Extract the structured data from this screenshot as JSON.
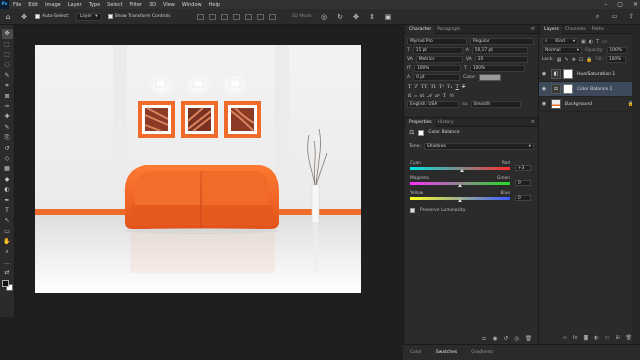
{
  "app": {
    "logo": "Ps"
  },
  "menu": [
    "File",
    "Edit",
    "Image",
    "Layer",
    "Type",
    "Select",
    "Filter",
    "3D",
    "View",
    "Window",
    "Help"
  ],
  "options_bar": {
    "auto_select_label": "Auto-Select:",
    "auto_select_value": "Layer",
    "transform_label": "Show Transform Controls",
    "mode_3d": "3D Mode:"
  },
  "toolbar": {
    "tools": [
      "move-tool",
      "artboard-tool",
      "marquee-tool",
      "lasso-tool",
      "quick-select-tool",
      "crop-tool",
      "frame-tool",
      "eyedropper-tool",
      "healing-tool",
      "brush-tool",
      "clone-stamp-tool",
      "history-brush-tool",
      "eraser-tool",
      "gradient-tool",
      "blur-tool",
      "dodge-tool",
      "pen-tool",
      "type-tool",
      "path-select-tool",
      "rectangle-tool",
      "hand-tool",
      "zoom-tool",
      "edit-toolbar",
      "swap-colors"
    ],
    "glyphs": [
      "✥",
      "⬚",
      "⬚",
      "◌",
      "✎",
      "⌗",
      "⊠",
      "✑",
      "✚",
      "✎",
      "⎘",
      "↺",
      "◇",
      "▦",
      "◆",
      "◐",
      "✒",
      "T",
      "↖",
      "▭",
      "✋",
      "⌕",
      "…",
      "⇄"
    ],
    "foreground": "#111111",
    "background": "#ffffff"
  },
  "character_panel": {
    "tabs": [
      "Character",
      "Paragraph"
    ],
    "font_family": "Myriad Pro",
    "font_style": "Regular",
    "font_size": "15 pt",
    "leading": "50,17 pt",
    "kerning": "Metrics",
    "tracking": "20",
    "vscale": "100%",
    "hscale": "100%",
    "baseline": "0 pt",
    "color_label": "Color:",
    "language": "English: USA",
    "aa_label": "aa",
    "antialias": "Smooth"
  },
  "properties_panel": {
    "tabs": [
      "Properties",
      "History"
    ],
    "title": "Color Balance",
    "tone_label": "Tone:",
    "tone_value": "Shadows",
    "sliders": [
      {
        "left": "Cyan",
        "right": "Red",
        "value": "+3",
        "position": 0.52
      },
      {
        "left": "Magenta",
        "right": "Green",
        "value": "0",
        "position": 0.5
      },
      {
        "left": "Yellow",
        "right": "Blue",
        "value": "0",
        "position": 0.5
      }
    ],
    "preserve_luminosity": "Preserve Luminosity"
  },
  "layers_panel": {
    "tabs": [
      "Layers",
      "Channels",
      "Paths"
    ],
    "kind": "Kind",
    "blend_mode": "Normal",
    "opacity_label": "Opacity:",
    "opacity": "100%",
    "lock_label": "Lock:",
    "fill_label": "Fill:",
    "fill": "100%",
    "layers": [
      {
        "name": "Hue/Saturation 1",
        "type": "adjustment",
        "selected": false
      },
      {
        "name": "Color Balance 1",
        "type": "adjustment",
        "selected": true
      },
      {
        "name": "Background",
        "type": "image",
        "selected": false
      }
    ]
  },
  "bottom_tabs": [
    "Color",
    "Swatches",
    "Gradients"
  ],
  "colors": {
    "accent_orange": "#f06a2a",
    "selection": "#3d4a5c"
  }
}
